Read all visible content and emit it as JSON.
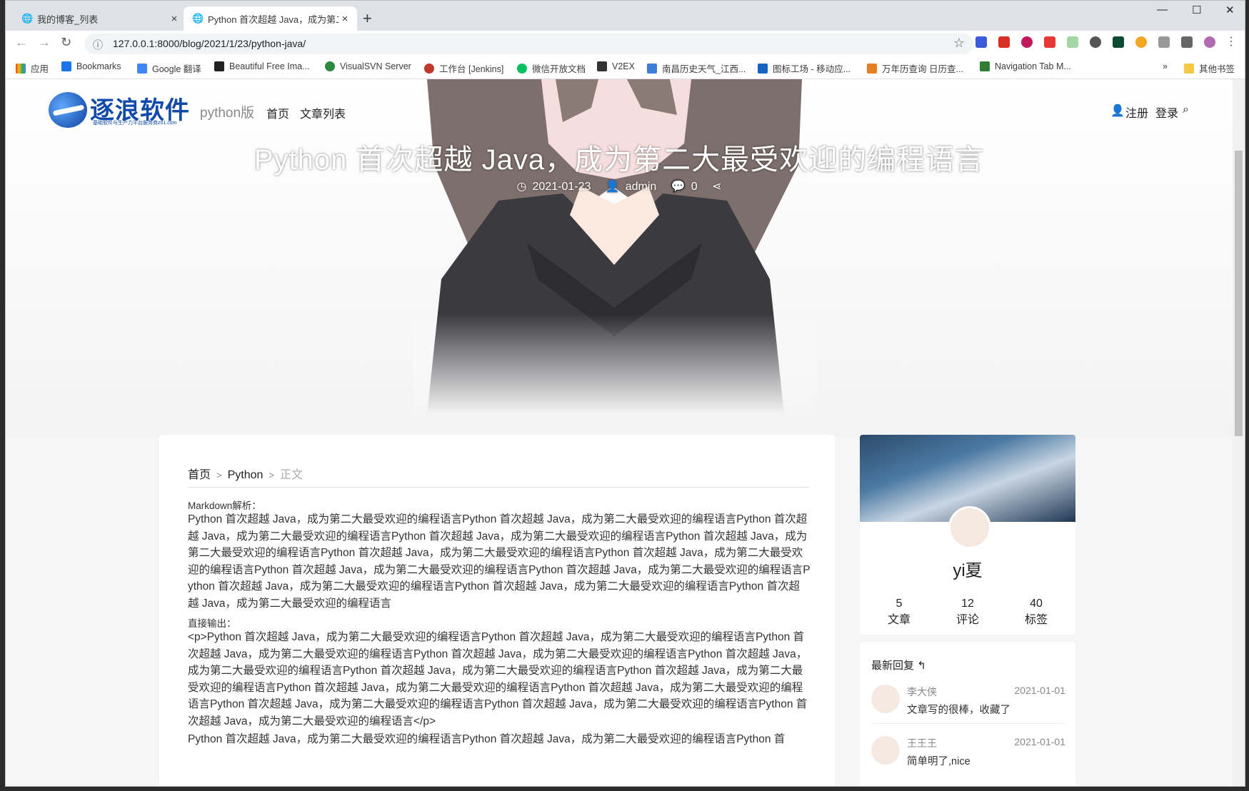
{
  "browser": {
    "tabs": [
      {
        "title": "我的博客_列表"
      },
      {
        "title": "Python 首次超越 Java，成为第二"
      }
    ],
    "url": "127.0.0.1:8000/blog/2021/1/23/python-java/",
    "bookmarks": [
      {
        "label": "应用",
        "color": "#4285f4"
      },
      {
        "label": "Bookmarks",
        "color": "#1a73e8"
      },
      {
        "label": "Google 翻译",
        "color": "#4285f4"
      },
      {
        "label": "Beautiful Free Ima...",
        "color": "#222222"
      },
      {
        "label": "VisualSVN Server",
        "color": "#2b8a3e"
      },
      {
        "label": "工作台 [Jenkins]",
        "color": "#c0392b"
      },
      {
        "label": "微信开放文档",
        "color": "#07c160"
      },
      {
        "label": "V2EX",
        "color": "#333333"
      },
      {
        "label": "南昌历史天气_江西...",
        "color": "#3b7dd8"
      },
      {
        "label": "图标工场 - 移动应...",
        "color": "#1565c0"
      },
      {
        "label": "万年历查询 日历查...",
        "color": "#e67e22"
      },
      {
        "label": "Navigation Tab M...",
        "color": "#2e7d32"
      }
    ],
    "other_bookmarks": "其他书签",
    "more_bookmarks": "»"
  },
  "site": {
    "logo_text": "逐浪软件",
    "logo_subtitle": "基础软件与生产力平台服务商z01.com",
    "logo_suffix": "python版",
    "nav": [
      "首页",
      "文章列表"
    ],
    "register": "注册",
    "login": "登录"
  },
  "post": {
    "title": "Python 首次超越 Java，成为第二大最受欢迎的编程语言",
    "date": "2021-01-23",
    "author": "admin",
    "comments": "0"
  },
  "breadcrumb": {
    "home": "首页",
    "category": "Python",
    "current": "正文",
    "separator": ">"
  },
  "article": {
    "markdown_label": "Markdown解析：",
    "markdown_text": "Python 首次超越 Java，成为第二大最受欢迎的编程语言Python 首次超越 Java，成为第二大最受欢迎的编程语言Python 首次超越 Java，成为第二大最受欢迎的编程语言Python 首次超越 Java，成为第二大最受欢迎的编程语言Python 首次超越 Java，成为第二大最受欢迎的编程语言Python 首次超越 Java，成为第二大最受欢迎的编程语言Python 首次超越 Java，成为第二大最受欢迎的编程语言Python 首次超越 Java，成为第二大最受欢迎的编程语言Python 首次超越 Java，成为第二大最受欢迎的编程语言Python 首次超越 Java，成为第二大最受欢迎的编程语言Python 首次超越 Java，成为第二大最受欢迎的编程语言Python 首次超越 Java，成为第二大最受欢迎的编程语言",
    "raw_label": "直接输出：",
    "raw_text": "<p>Python 首次超越 Java，成为第二大最受欢迎的编程语言Python 首次超越 Java，成为第二大最受欢迎的编程语言Python 首次超越 Java，成为第二大最受欢迎的编程语言Python 首次超越 Java，成为第二大最受欢迎的编程语言Python 首次超越 Java，成为第二大最受欢迎的编程语言Python 首次超越 Java，成为第二大最受欢迎的编程语言Python 首次超越 Java，成为第二大最受欢迎的编程语言Python 首次超越 Java，成为第二大最受欢迎的编程语言Python 首次超越 Java，成为第二大最受欢迎的编程语言Python 首次超越 Java，成为第二大最受欢迎的编程语言Python 首次超越 Java，成为第二大最受欢迎的编程语言Python 首次超越 Java，成为第二大最受欢迎的编程语言</p>",
    "trailing_text": "Python 首次超越 Java，成为第二大最受欢迎的编程语言Python 首次超越 Java，成为第二大最受欢迎的编程语言Python 首"
  },
  "profile": {
    "name": "yi夏",
    "stats": [
      {
        "value": "5",
        "label": "文章"
      },
      {
        "value": "12",
        "label": "评论"
      },
      {
        "value": "40",
        "label": "标签"
      }
    ]
  },
  "recent_replies": {
    "title": "最新回复",
    "items": [
      {
        "name": "李大侠",
        "date": "2021-01-01",
        "text": "文章写的很棒，收藏了"
      },
      {
        "name": "王王王",
        "date": "2021-01-01",
        "text": "简单明了,nice"
      }
    ]
  }
}
